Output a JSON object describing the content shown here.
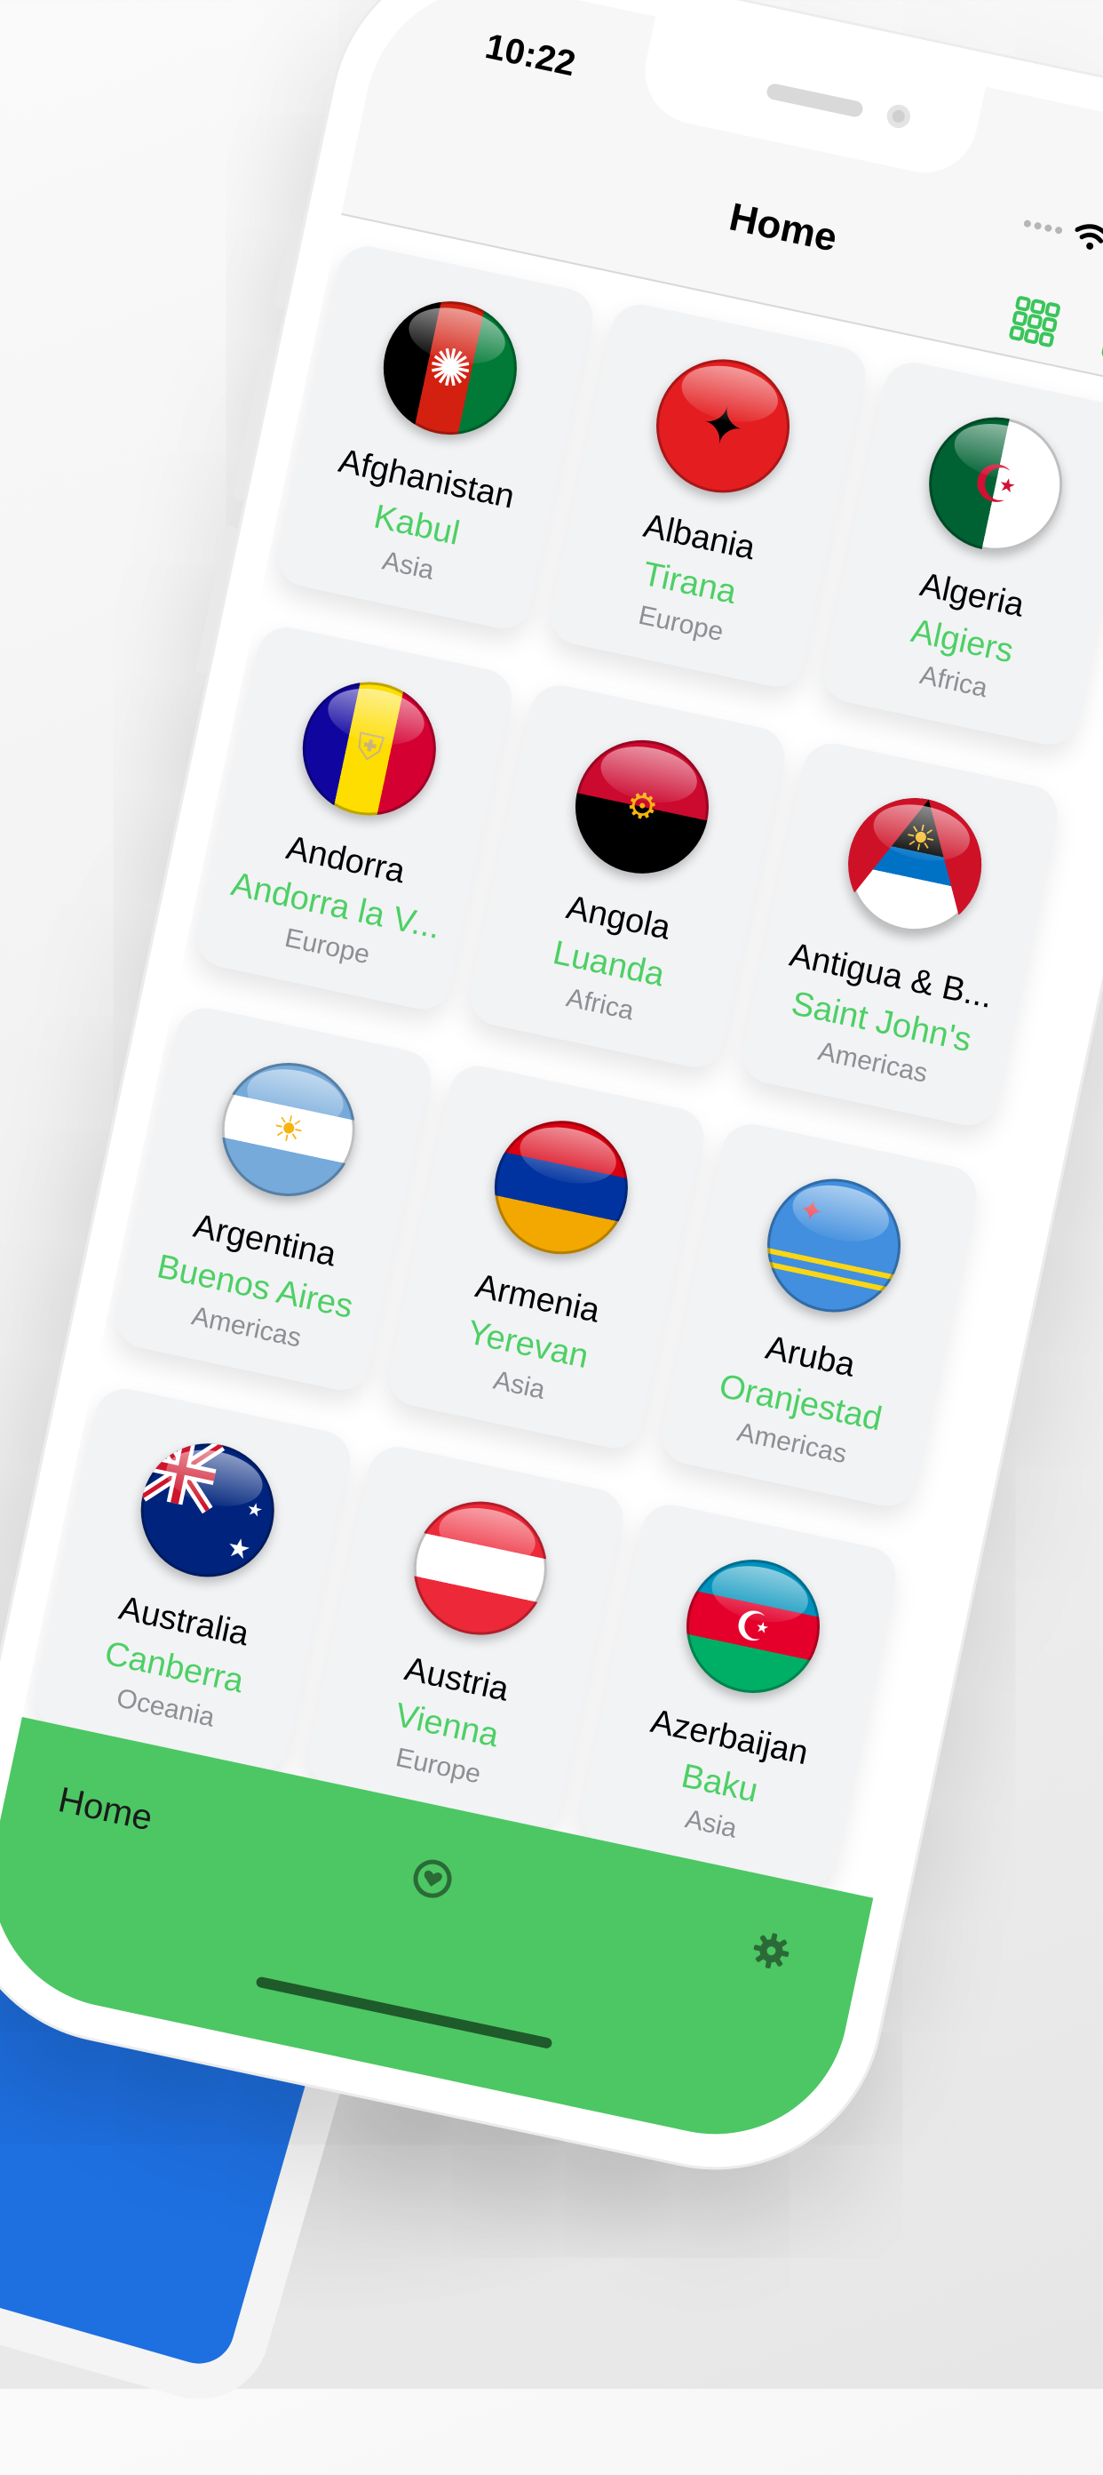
{
  "status_bar": {
    "time": "10:22"
  },
  "nav": {
    "title": "Home"
  },
  "countries": [
    {
      "name": "Afghanistan",
      "capital": "Kabul",
      "region": "Asia",
      "flag": "af"
    },
    {
      "name": "Albania",
      "capital": "Tirana",
      "region": "Europe",
      "flag": "al"
    },
    {
      "name": "Algeria",
      "capital": "Algiers",
      "region": "Africa",
      "flag": "dz"
    },
    {
      "name": "Andorra",
      "capital": "Andorra la V...",
      "region": "Europe",
      "flag": "ad"
    },
    {
      "name": "Angola",
      "capital": "Luanda",
      "region": "Africa",
      "flag": "ao"
    },
    {
      "name": "Antigua & B...",
      "capital": "Saint John's",
      "region": "Americas",
      "flag": "ag"
    },
    {
      "name": "Argentina",
      "capital": "Buenos Aires",
      "region": "Americas",
      "flag": "ar"
    },
    {
      "name": "Armenia",
      "capital": "Yerevan",
      "region": "Asia",
      "flag": "am"
    },
    {
      "name": "Aruba",
      "capital": "Oranjestad",
      "region": "Americas",
      "flag": "aw"
    },
    {
      "name": "Australia",
      "capital": "Canberra",
      "region": "Oceania",
      "flag": "au"
    },
    {
      "name": "Austria",
      "capital": "Vienna",
      "region": "Europe",
      "flag": "at"
    },
    {
      "name": "Azerbaijan",
      "capital": "Baku",
      "region": "Asia",
      "flag": "az"
    }
  ],
  "tab_bar": {
    "home_label": "Home",
    "icons": [
      "heart-icon",
      "gear-icon"
    ]
  },
  "colors": {
    "accent": "#4cd064",
    "tab_bar": "#4cc763",
    "card": "#f2f3f5",
    "region_text": "#8e8e93"
  }
}
